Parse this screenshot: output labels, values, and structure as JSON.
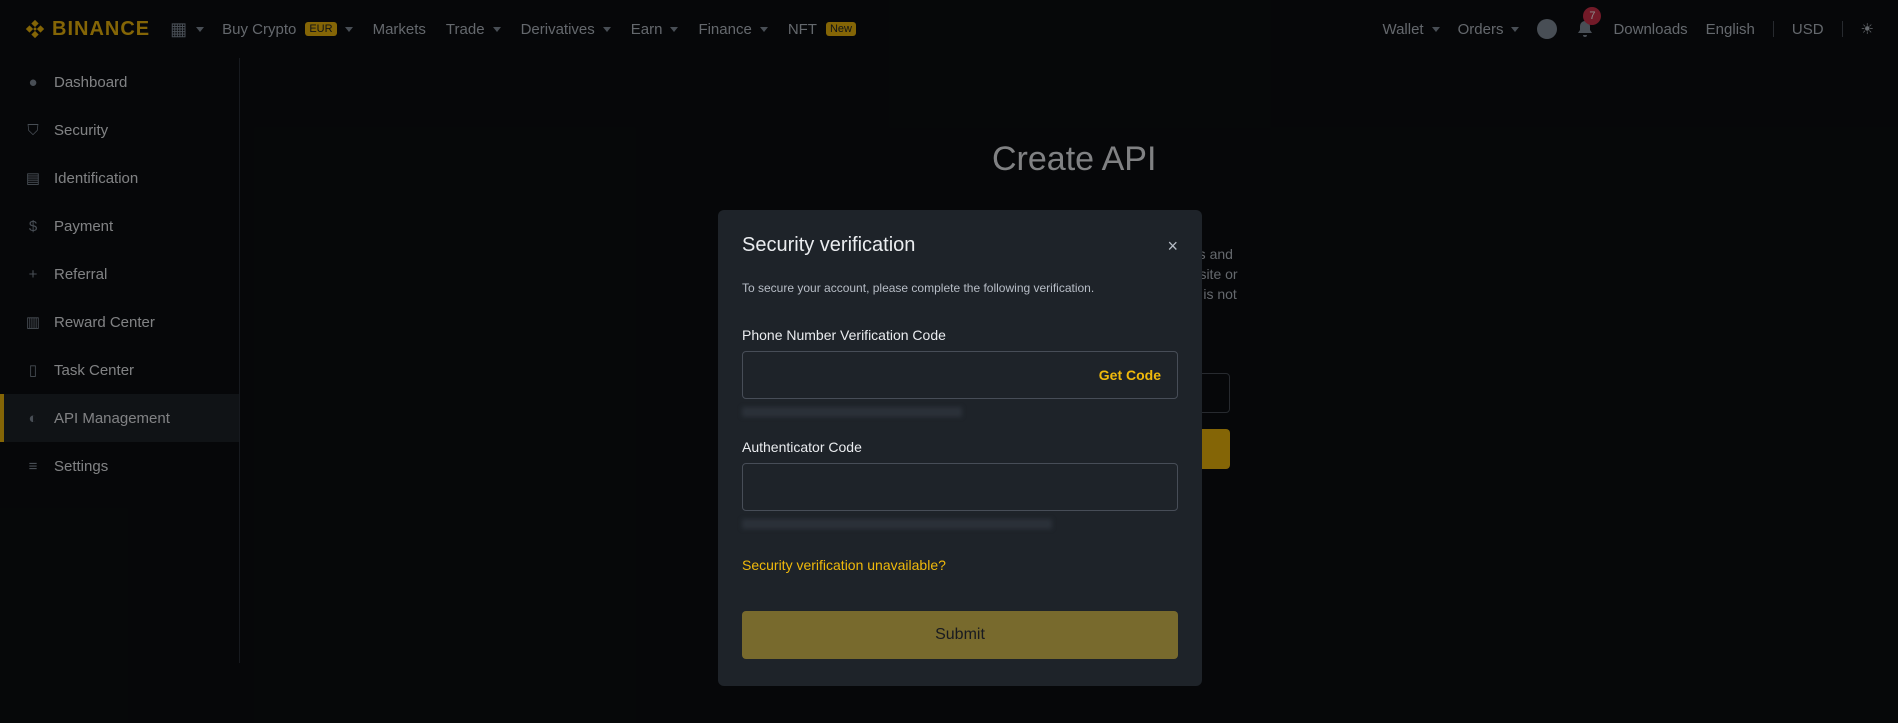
{
  "header": {
    "logo": "BINANCE",
    "nav": [
      {
        "label": "Buy Crypto",
        "badge": "EUR"
      },
      {
        "label": "Markets"
      },
      {
        "label": "Trade"
      },
      {
        "label": "Derivatives"
      },
      {
        "label": "Earn"
      },
      {
        "label": "Finance"
      },
      {
        "label": "NFT",
        "badge": "New"
      }
    ],
    "right": {
      "wallet": "Wallet",
      "orders": "Orders",
      "notifications": "7",
      "downloads": "Downloads",
      "language": "English",
      "currency": "USD"
    }
  },
  "sidebar": {
    "items": [
      {
        "label": "Dashboard",
        "icon": "user-icon"
      },
      {
        "label": "Security",
        "icon": "shield-icon"
      },
      {
        "label": "Identification",
        "icon": "id-card-icon"
      },
      {
        "label": "Payment",
        "icon": "dollar-icon"
      },
      {
        "label": "Referral",
        "icon": "user-plus-icon"
      },
      {
        "label": "Reward Center",
        "icon": "ticket-icon"
      },
      {
        "label": "Task Center",
        "icon": "clipboard-icon"
      },
      {
        "label": "API Management",
        "icon": "api-icon",
        "active": true
      },
      {
        "label": "Settings",
        "icon": "sliders-icon"
      }
    ]
  },
  "main": {
    "title": "Create API",
    "text_fragments": [
      "kets and",
      "rty site or",
      "YC is not"
    ]
  },
  "modal": {
    "title": "Security verification",
    "close": "×",
    "subtitle": "To secure your account, please complete the following verification.",
    "phone_label": "Phone Number Verification Code",
    "get_code": "Get Code",
    "auth_label": "Authenticator Code",
    "unavailable_link": "Security verification unavailable?",
    "submit": "Submit"
  },
  "colors": {
    "accent": "#f0b90b",
    "background": "#0b0e11",
    "modal": "#1e2329"
  }
}
